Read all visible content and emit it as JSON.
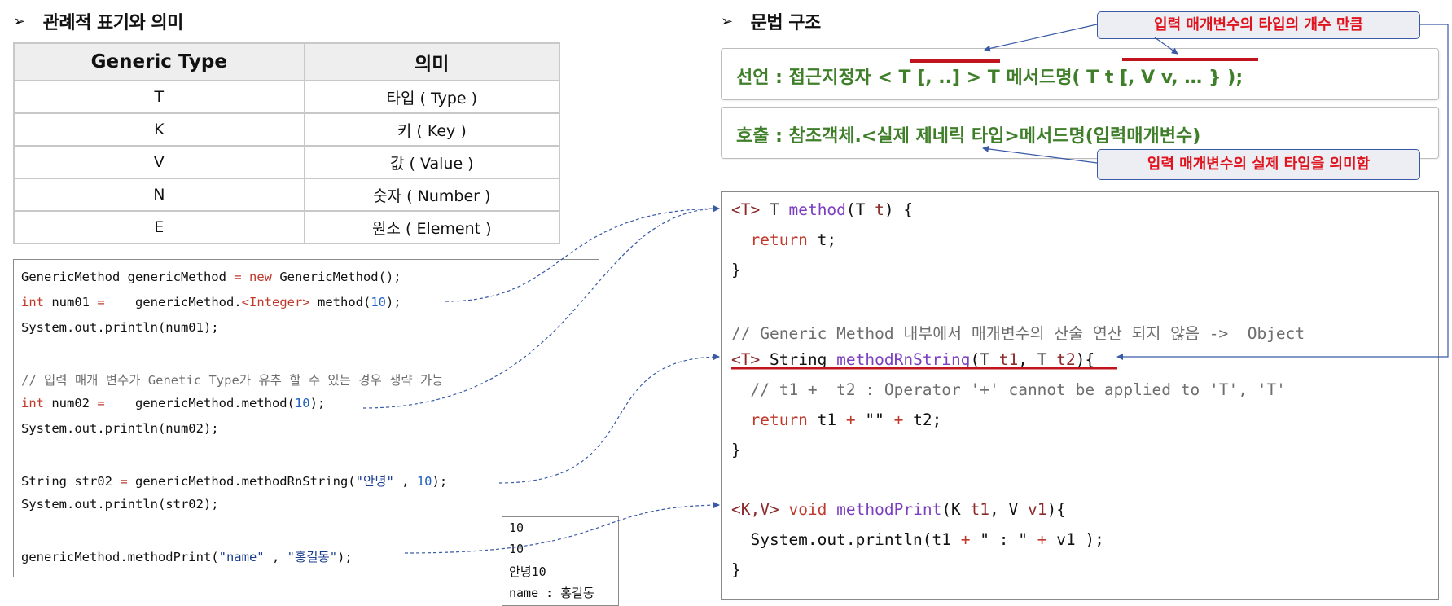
{
  "left_section": {
    "bullet": "➢",
    "title": "관례적 표기와 의미",
    "table": {
      "headers": [
        "Generic Type",
        "의미"
      ],
      "rows": [
        [
          "T",
          "타입 ( Type )"
        ],
        [
          "K",
          "키 ( Key )"
        ],
        [
          "V",
          "값 ( Value )"
        ],
        [
          "N",
          "숫자 ( Number )"
        ],
        [
          "E",
          "원소 ( Element )"
        ]
      ]
    }
  },
  "right_section": {
    "bullet": "➢",
    "title": "문법 구조",
    "declaration": "선언 : 접근지정자 < T [, ..] > T 메서드명( T t [, V v, … } );",
    "invocation": "호출 : 참조객체.<실제 제네릭 타입>메서드명(입력매개변수)",
    "callout_top": "입력 매개변수의 타입의 개수 만큼",
    "callout_bottom": "입력 매개변수의 실제 타입을 의미함"
  },
  "left_code": {
    "l1a": "GenericMethod genericMethod ",
    "l1b": "=",
    "l1c": " ",
    "l1d": "new",
    "l1e": " GenericMethod();",
    "l2a": "int",
    "l2b": " num01 ",
    "l2c": "=",
    "l2d": "    genericMethod.",
    "l2e": "<Integer>",
    "l2f": " method(",
    "l2g": "10",
    "l2h": ");",
    "l3": "System.out.println(num01);",
    "l5": "// 입력 매개 변수가 Genetic Type가 유추 할 수 있는 경우 생략 가능",
    "l6a": "int",
    "l6b": " num02 ",
    "l6c": "=",
    "l6d": "    genericMethod.method(",
    "l6e": "10",
    "l6f": ");",
    "l7": "System.out.println(num02);",
    "l9a": "String str02 ",
    "l9b": "=",
    "l9c": " genericMethod.methodRnString(",
    "l9d": "\"안녕\"",
    "l9e": " , ",
    "l9f": "10",
    "l9g": ");",
    "l10": "System.out.println(str02);",
    "l12a": "genericMethod.methodPrint(",
    "l12b": "\"name\"",
    "l12c": " , ",
    "l12d": "\"홍길동\"",
    "l12e": ");"
  },
  "output": [
    "10",
    "10",
    "안녕10",
    "name : 홍길동"
  ],
  "right_code": {
    "r1a": "<T>",
    "r1b": " T ",
    "r1c": "method",
    "r1d": "(T ",
    "r1e": "t",
    "r1f": ") {",
    "r2a": "  ",
    "r2b": "return",
    "r2c": " t;",
    "r3": "}",
    "r5": "// Generic Method 내부에서 매개변수의 산술 연산 되지 않음 ->  Object",
    "r6a": "<T>",
    "r6b": " String ",
    "r6c": "methodRnString",
    "r6d": "(T ",
    "r6e": "t1",
    "r6f": ", T ",
    "r6g": "t2",
    "r6h": "){",
    "r7": "  // t1 +  t2 : Operator '+' cannot be applied to 'T', 'T'",
    "r8a": "  ",
    "r8b": "return",
    "r8c": " t1 ",
    "r8d": "+",
    "r8e": " \"\" ",
    "r8f": "+",
    "r8g": " t2;",
    "r9": "}",
    "r11a": "<K,V>",
    "r11b": " ",
    "r11c": "void",
    "r11d": " ",
    "r11e": "methodPrint",
    "r11f": "(K ",
    "r11g": "t1",
    "r11h": ", V ",
    "r11i": "v1",
    "r11j": "){",
    "r12a": "  System.out.println(t1 ",
    "r12b": "+",
    "r12c": " \" : \" ",
    "r12d": "+",
    "r12e": " v1 );",
    "r13": "}"
  },
  "colors": {
    "keyword": "#c0392b",
    "number": "#1f5fbf",
    "comment": "#6e6e6e",
    "syntax_text": "#3f7f2a",
    "callout_text": "#e0141e",
    "connector": "#3a5aa6",
    "underline": "#c0141e"
  }
}
